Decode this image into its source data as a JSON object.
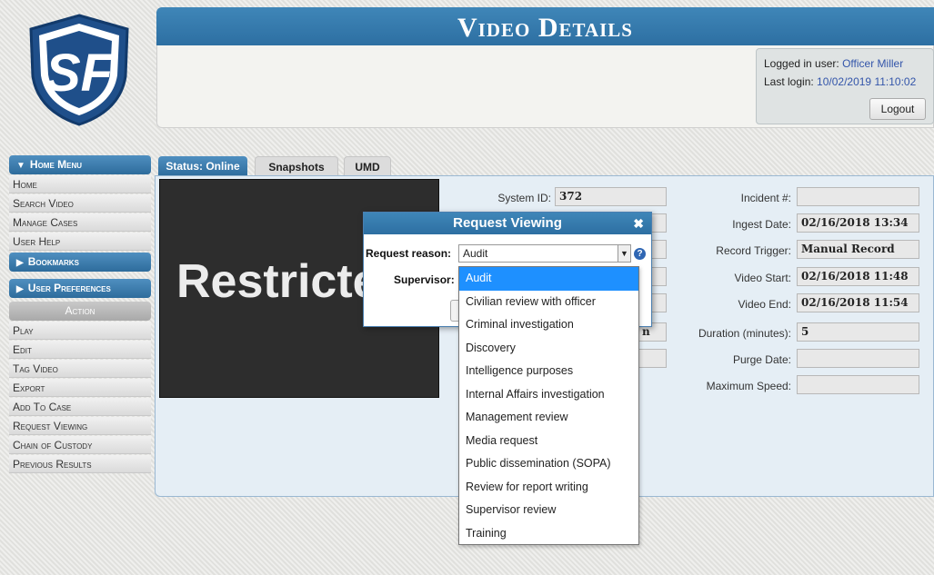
{
  "header": {
    "title": "Video Details"
  },
  "login": {
    "user_label": "Logged in user:",
    "user_value": "Officer Miller",
    "last_label": "Last login:",
    "last_value": "10/02/2019 11:10:02",
    "logout": "Logout"
  },
  "sidebar": {
    "home_menu": "Home Menu",
    "home_items": [
      "Home",
      "Search Video",
      "Manage Cases",
      "User Help"
    ],
    "bookmarks": "Bookmarks",
    "user_prefs": "User Preferences",
    "action": "Action",
    "action_items": [
      "Play",
      "Edit",
      "Tag Video",
      "Export",
      "Add To Case",
      "Request Viewing",
      "Chain of Custody",
      "Previous Results"
    ]
  },
  "tabs": [
    "Status: Online",
    "Snapshots",
    "UMD"
  ],
  "video": {
    "overlay_text": "Restricted"
  },
  "fields_left": {
    "system_id_label": "System ID:",
    "system_id_value": "372",
    "partial_value": "n"
  },
  "fields_right": [
    {
      "label": "Incident #:",
      "value": ""
    },
    {
      "label": "Ingest Date:",
      "value": "02/16/2018 13:34"
    },
    {
      "label": "Record Trigger:",
      "value": "Manual Record"
    },
    {
      "label": "Video Start:",
      "value": "02/16/2018 11:48"
    },
    {
      "label": "Video End:",
      "value": "02/16/2018 11:54"
    },
    {
      "label": "Duration (minutes):",
      "value": "5"
    },
    {
      "label": "Purge Date:",
      "value": ""
    },
    {
      "label": "Maximum Speed:",
      "value": ""
    }
  ],
  "modal": {
    "title": "Request Viewing",
    "reason_label": "Request reason:",
    "reason_value": "Audit",
    "supervisor_label": "Supervisor:"
  },
  "dropdown": {
    "selected": "Audit",
    "options": [
      "Audit",
      "Civilian review with officer",
      "Criminal investigation",
      "Discovery",
      "Intelligence purposes",
      "Internal Affairs investigation",
      "Management review",
      "Media request",
      "Public dissemination (SOPA)",
      "Review for report writing",
      "Supervisor review",
      "Training"
    ]
  },
  "colors": {
    "brand_blue": "#2d6fa2",
    "link_blue": "#3355aa",
    "selection": "#1e90ff"
  }
}
